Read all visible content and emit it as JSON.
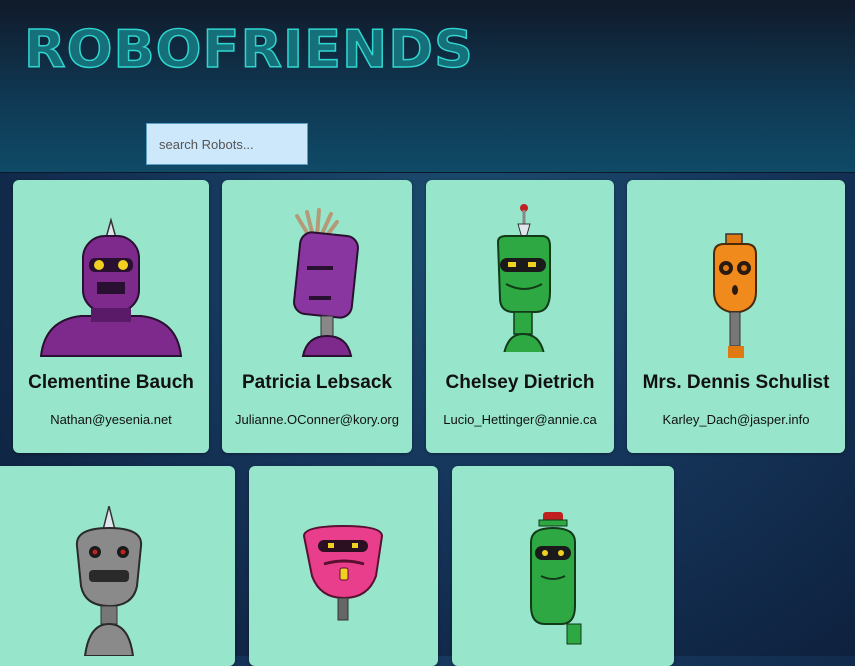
{
  "app": {
    "title": "ROBOFRIENDS"
  },
  "search": {
    "placeholder": "search Robots..."
  },
  "robots": [
    {
      "name": "Clementine Bauch",
      "email": "Nathan@yesenia.net"
    },
    {
      "name": "Patricia Lebsack",
      "email": "Julianne.OConner@kory.org"
    },
    {
      "name": "Chelsey Dietrich",
      "email": "Lucio_Hettinger@annie.ca"
    },
    {
      "name": "Mrs. Dennis Schulist",
      "email": "Karley_Dach@jasper.info"
    },
    {
      "name": "",
      "email": ""
    },
    {
      "name": "",
      "email": ""
    },
    {
      "name": "",
      "email": ""
    }
  ],
  "colors": {
    "card": "#97e6cb",
    "logo_outline": "#2fd6d0",
    "search_bg": "#cde8fb"
  }
}
